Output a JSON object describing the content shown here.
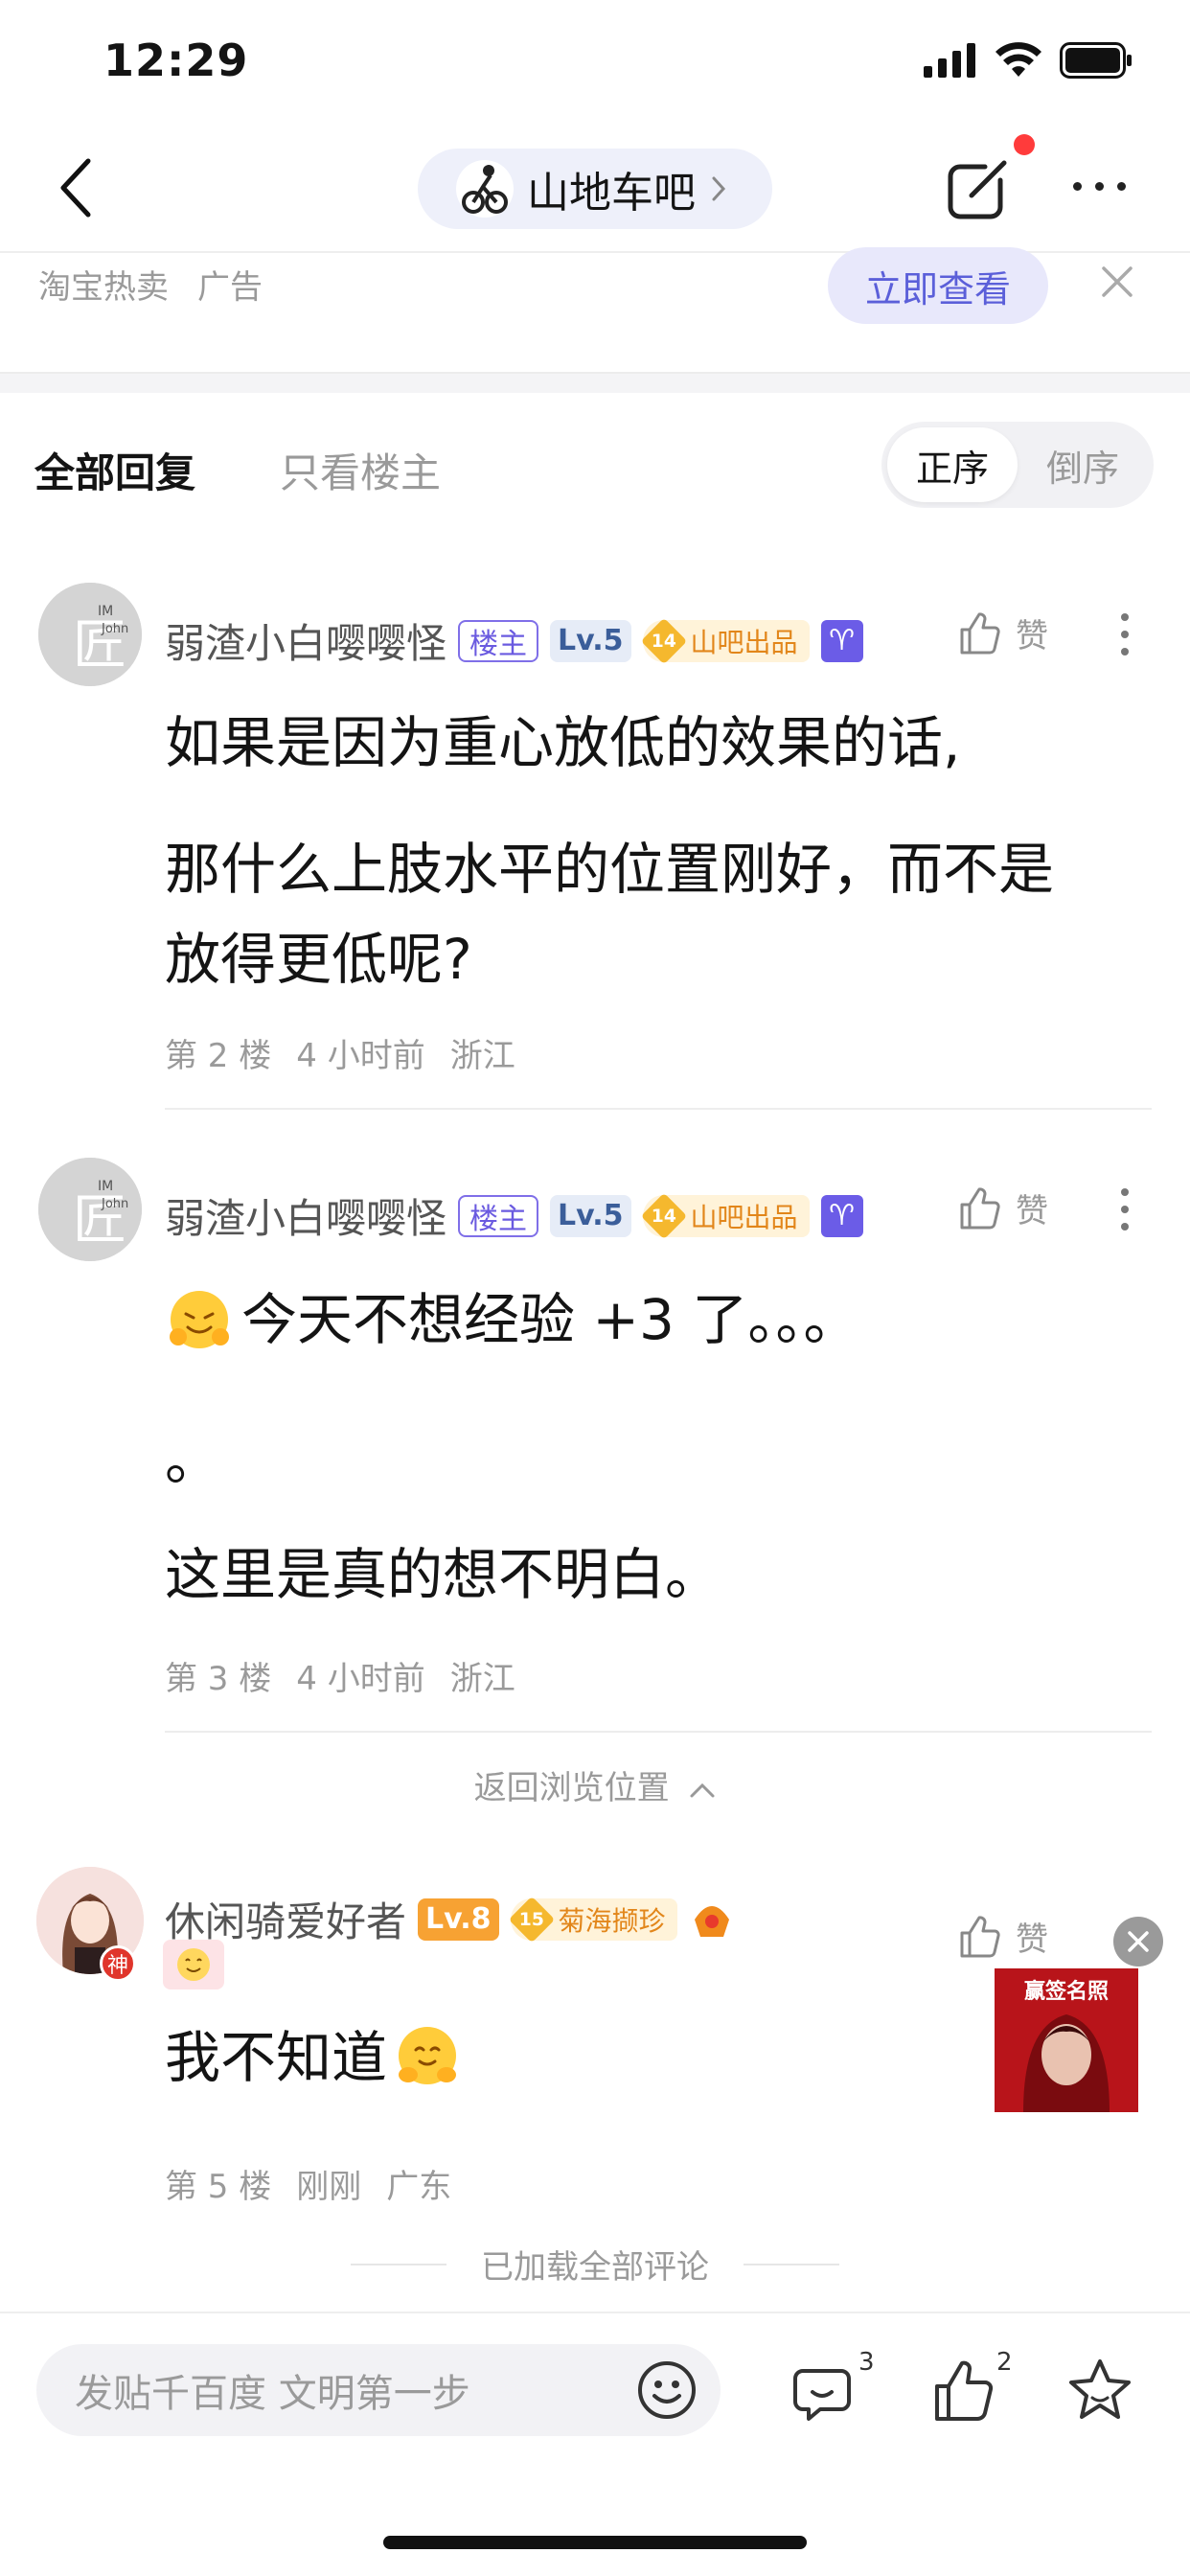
{
  "status_bar": {
    "time": "12:29"
  },
  "nav": {
    "forum_name": "山地车吧"
  },
  "ad": {
    "source": "淘宝热卖",
    "tag": "广告",
    "cta": "立即查看"
  },
  "tabs": {
    "all": "全部回复",
    "op_only": "只看楼主"
  },
  "sort": {
    "asc": "正序",
    "desc": "倒序"
  },
  "posts": [
    {
      "avatar_text": "匠",
      "username": "弱渣小白嘤嘤怪",
      "owner_badge": "楼主",
      "level": "Lv.5",
      "honor_num": "14",
      "honor_label": "山吧出品",
      "zodiac": "♈",
      "like_label": "赞",
      "content": [
        "如果是因为重心放低的效果的话,",
        "那什么上肢水平的位置刚好，而不是",
        "放得更低呢?"
      ],
      "floor": "第 2 楼",
      "time": "4 小时前",
      "region": "浙江"
    },
    {
      "avatar_text": "匠",
      "username": "弱渣小白嘤嘤怪",
      "owner_badge": "楼主",
      "level": "Lv.5",
      "honor_num": "14",
      "honor_label": "山吧出品",
      "zodiac": "♈",
      "like_label": "赞",
      "content": [
        "今天不想经验 +3 了。。。",
        "。",
        "这里是真的想不明白。"
      ],
      "floor": "第 3 楼",
      "time": "4 小时前",
      "region": "浙江"
    },
    {
      "username": "休闲骑爱好者",
      "level": "Lv.8",
      "honor_num": "15",
      "honor_label": "菊海撷珍",
      "god_badge": "神",
      "like_label": "赞",
      "content": [
        "我不知道"
      ],
      "floor": "第 5 楼",
      "time": "刚刚",
      "region": "广东"
    }
  ],
  "back_to_position": "返回浏览位置",
  "all_loaded": "已加载全部评论",
  "float_ad": {
    "title": "赢签名照"
  },
  "bottom_bar": {
    "placeholder": "发贴千百度 文明第一步",
    "comment_count": "3",
    "like_count": "2"
  },
  "colors": {
    "accent": "#6b5ce7",
    "honor": "#f5b82e",
    "red": "#ff3b3b"
  }
}
